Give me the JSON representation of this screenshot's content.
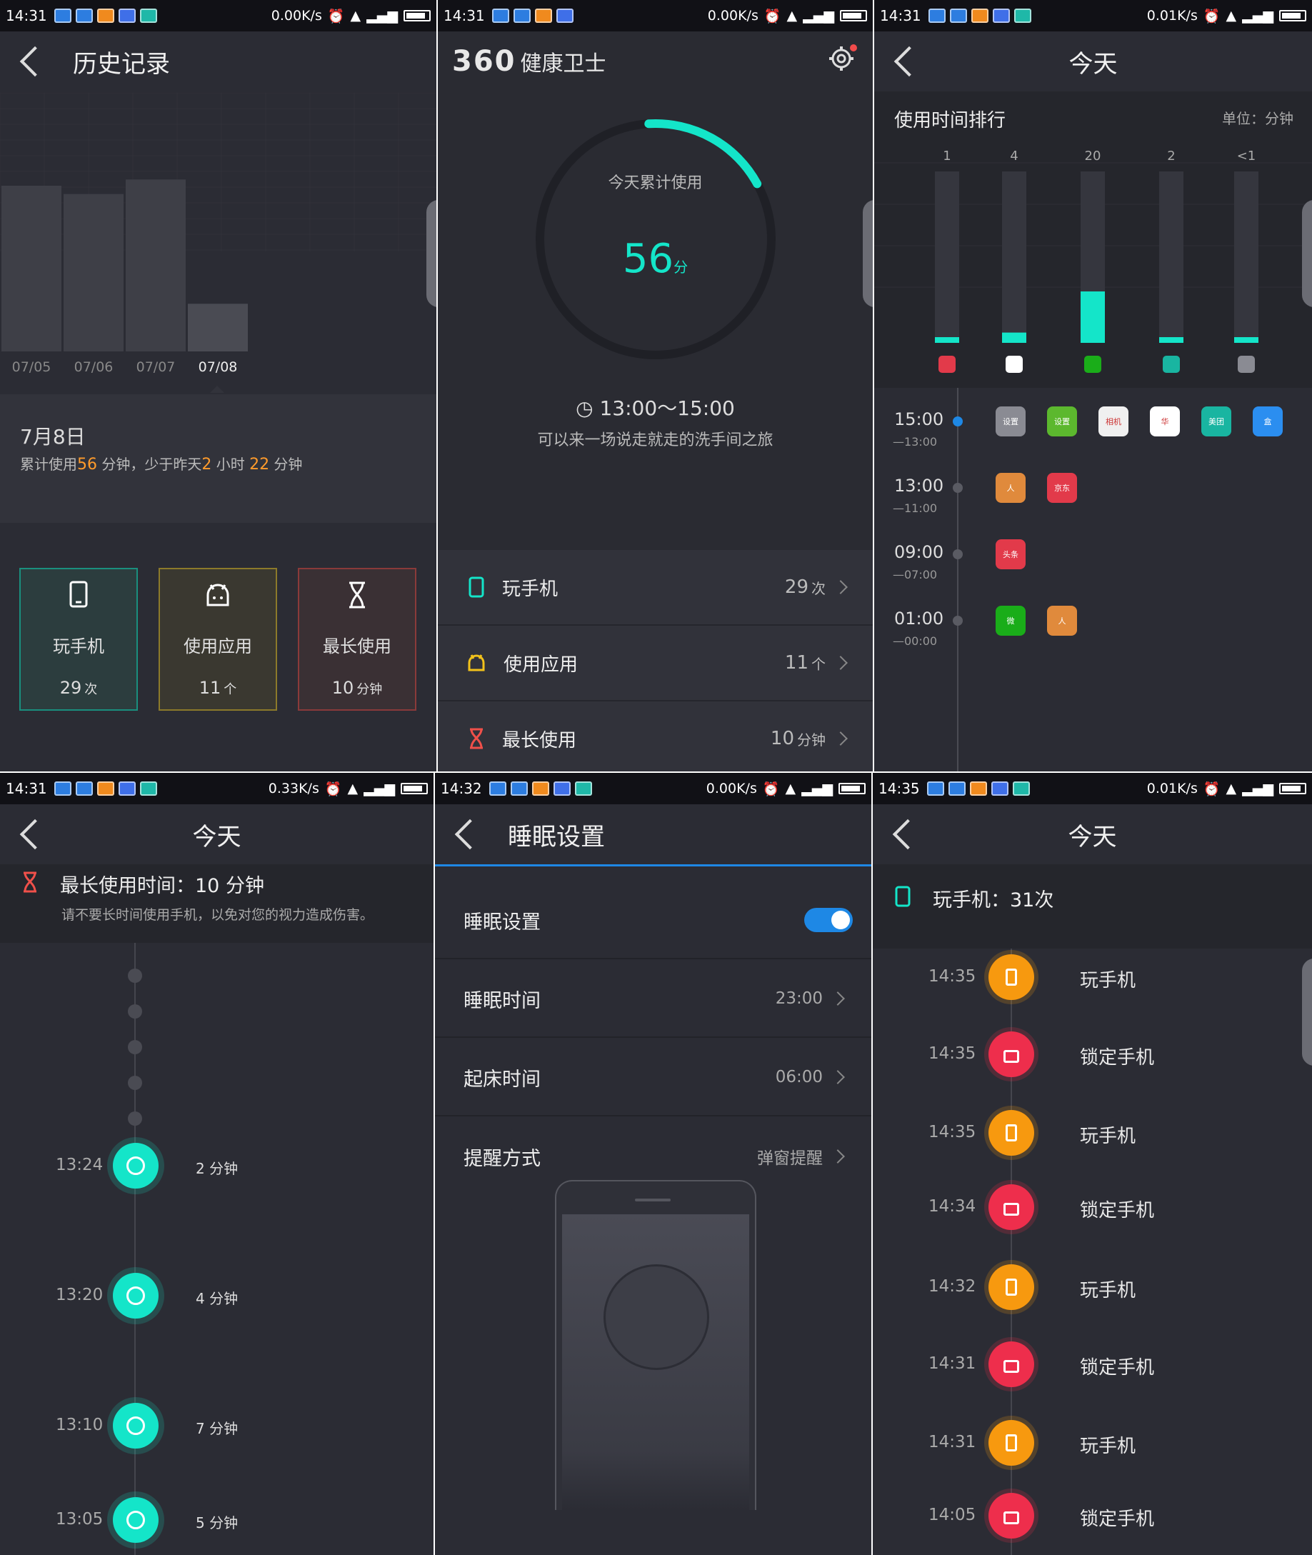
{
  "status_bars": [
    {
      "time": "14:31",
      "speed": "0.00K/s"
    },
    {
      "time": "14:31",
      "speed": "0.00K/s"
    },
    {
      "time": "14:31",
      "speed": "0.01K/s"
    },
    {
      "time": "14:31",
      "speed": "0.33K/s"
    },
    {
      "time": "14:32",
      "speed": "0.00K/s"
    },
    {
      "time": "14:35",
      "speed": "0.01K/s"
    }
  ],
  "history": {
    "title": "历史记录",
    "chart_data": {
      "type": "bar",
      "categories": [
        "07/05",
        "07/06",
        "07/07",
        "07/08"
      ],
      "values": [
        0.8,
        0.76,
        0.83,
        0.23
      ],
      "selected": "07/08"
    },
    "date": "7月8日",
    "summary": {
      "prefix": "累计使用",
      "used": "56",
      "mid": " 分钟，少于昨天",
      "hours": "2",
      "hours_unit": " 小时 ",
      "mins": "22",
      "suffix": " 分钟"
    },
    "cards": [
      {
        "label": "玩手机",
        "value": "29",
        "unit": "次"
      },
      {
        "label": "使用应用",
        "value": "11",
        "unit": "个"
      },
      {
        "label": "最长使用",
        "value": "10",
        "unit": "分钟"
      }
    ]
  },
  "home": {
    "logo_num": "360",
    "logo_text": "健康卫士",
    "ring_label": "今天累计使用",
    "ring_value": "56",
    "ring_unit": "分",
    "ring_progress": 0.18,
    "time_range": "13:00～15:00",
    "tip": "可以来一场说走就走的洗手间之旅",
    "rows": [
      {
        "label": "玩手机",
        "value": "29",
        "unit": "次",
        "color": "#14e5c9"
      },
      {
        "label": "使用应用",
        "value": "11",
        "unit": "个",
        "color": "#f2c21b"
      },
      {
        "label": "最长使用",
        "value": "10",
        "unit": "分钟",
        "color": "#f0504a"
      }
    ]
  },
  "ranking": {
    "title": "今天",
    "section": "使用时间排行",
    "unit": "单位：分钟",
    "chart_data": {
      "type": "bar",
      "categories": [
        "京东",
        "相机",
        "微信",
        "美团",
        "设置"
      ],
      "values": [
        1,
        4,
        20,
        2,
        0.5
      ],
      "labels": [
        "1",
        "4",
        "20",
        "2",
        "<1"
      ],
      "ylim": [
        0,
        20
      ]
    },
    "icon_labels": [
      "京东",
      "",
      "",
      "美团",
      ""
    ],
    "timeline": [
      {
        "time": "15:00",
        "sub": "—13:00",
        "icons": [
          "设置",
          "设置",
          "相机",
          "华",
          "美团",
          "盒"
        ]
      },
      {
        "time": "13:00",
        "sub": "—11:00",
        "icons": [
          "人",
          "京东"
        ]
      },
      {
        "time": "09:00",
        "sub": "—07:00",
        "icons": [
          "头条"
        ]
      },
      {
        "time": "01:00",
        "sub": "—00:00",
        "icons": [
          "微",
          "人"
        ]
      }
    ]
  },
  "longest": {
    "title": "今天",
    "header": "最长使用时间：10 分钟",
    "tip": "请不要长时间使用手机，以免对您的视力造成伤害。",
    "events": [
      {
        "time": "13:24",
        "duration": "2 分钟"
      },
      {
        "time": "13:20",
        "duration": "4 分钟"
      },
      {
        "time": "13:10",
        "duration": "7 分钟"
      },
      {
        "time": "13:05",
        "duration": "5 分钟"
      }
    ]
  },
  "sleep": {
    "title": "睡眠设置",
    "rows": [
      {
        "label": "睡眠设置",
        "value": ""
      },
      {
        "label": "睡眠时间",
        "value": "23:00"
      },
      {
        "label": "起床时间",
        "value": "06:00"
      },
      {
        "label": "提醒方式",
        "value": "弹窗提醒"
      }
    ],
    "toggle_on": true
  },
  "unlocks": {
    "title": "今天",
    "header": "玩手机：31次",
    "events": [
      {
        "time": "14:35",
        "label": "玩手机",
        "kind": "play"
      },
      {
        "time": "14:35",
        "label": "锁定手机",
        "kind": "lock"
      },
      {
        "time": "14:35",
        "label": "玩手机",
        "kind": "play"
      },
      {
        "time": "14:34",
        "label": "锁定手机",
        "kind": "lock"
      },
      {
        "time": "14:32",
        "label": "玩手机",
        "kind": "play"
      },
      {
        "time": "14:31",
        "label": "锁定手机",
        "kind": "lock"
      },
      {
        "time": "14:31",
        "label": "玩手机",
        "kind": "play"
      },
      {
        "time": "14:05",
        "label": "锁定手机",
        "kind": "lock"
      }
    ]
  }
}
